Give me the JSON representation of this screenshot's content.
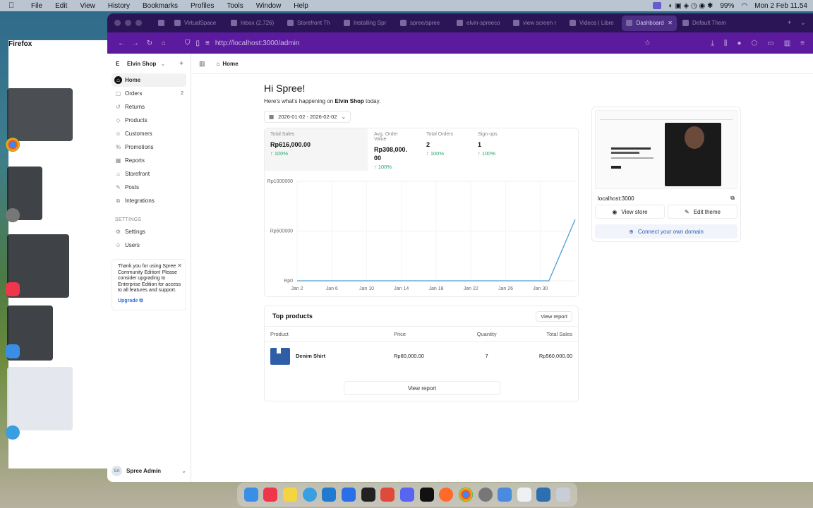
{
  "menubar": {
    "app": "Firefox",
    "items": [
      "File",
      "Edit",
      "View",
      "History",
      "Bookmarks",
      "Profiles",
      "Tools",
      "Window",
      "Help"
    ],
    "battery": "99%",
    "clock": "Mon 2 Feb  11.54"
  },
  "browser": {
    "tabs": [
      "VirtualSpace",
      "Inbox (2,726)",
      "Storefront Th",
      "Installing Spr",
      "spree/spree",
      "elvin-spreeco",
      "view screen r",
      "Videos | Libre",
      "Dashboard",
      "Default Them"
    ],
    "active_tab": "Dashboard",
    "url": "http://localhost:3000/admin"
  },
  "sidebar": {
    "shop_initial": "E",
    "shop_name": "Elvin Shop",
    "items": [
      {
        "label": "Home",
        "count": ""
      },
      {
        "label": "Orders",
        "count": "2"
      },
      {
        "label": "Returns",
        "count": ""
      },
      {
        "label": "Products",
        "count": ""
      },
      {
        "label": "Customers",
        "count": ""
      },
      {
        "label": "Promotions",
        "count": ""
      },
      {
        "label": "Reports",
        "count": ""
      },
      {
        "label": "Storefront",
        "count": ""
      },
      {
        "label": "Posts",
        "count": ""
      },
      {
        "label": "Integrations",
        "count": ""
      }
    ],
    "settings_label": "SETTINGS",
    "settings_items": [
      "Settings",
      "Users"
    ],
    "notice_text": "Thank you for using Spree Community Edition! Please consider upgrading to Enterprise Edition for access to all features and support.",
    "upgrade_label": "Upgrade",
    "user_name": "Spree Admin",
    "user_initials": "SA"
  },
  "topbar": {
    "crumb": "Home"
  },
  "main": {
    "greeting": "Hi Spree!",
    "sub_prefix": "Here's what's happening on ",
    "sub_shop": "Elvin Shop",
    "sub_suffix": " today.",
    "date_range": "2026-01-02 - 2026-02-02",
    "stats": [
      {
        "label": "Total Sales",
        "value": "Rp616,000.00",
        "change": "100%"
      },
      {
        "label": "Avg. Order Value",
        "value": "Rp308,000.00",
        "change": "100%"
      },
      {
        "label": "Total Orders",
        "value": "2",
        "change": "100%"
      },
      {
        "label": "Sign-ups",
        "value": "1",
        "change": "100%"
      }
    ]
  },
  "chart_data": {
    "type": "line",
    "x": [
      "Jan 2",
      "Jan 6",
      "Jan 10",
      "Jan 14",
      "Jan 18",
      "Jan 22",
      "Jan 26",
      "Jan 30",
      "Feb 2"
    ],
    "x_ticks": [
      "Jan 2",
      "Jan 6",
      "Jan 10",
      "Jan 14",
      "Jan 18",
      "Jan 22",
      "Jan 26",
      "Jan 30"
    ],
    "y_ticks": [
      "Rp0",
      "Rp500000",
      "Rp1000000"
    ],
    "series": [
      {
        "values": [
          0,
          0,
          0,
          0,
          0,
          0,
          0,
          0,
          616000
        ]
      }
    ],
    "ylim": [
      0,
      1000000
    ],
    "color": "#4a9fd8"
  },
  "top_products": {
    "title": "Top products",
    "view_report": "View report",
    "columns": [
      "Product",
      "Price",
      "Quantity",
      "Total Sales"
    ],
    "rows": [
      {
        "name": "Denim Shirt",
        "price": "Rp80,000.00",
        "quantity": "7",
        "total": "Rp560,000.00"
      }
    ],
    "footer_button": "View report"
  },
  "store": {
    "domain": "localhost:3000",
    "view_store": "View store",
    "edit_theme": "Edit theme",
    "connect": "Connect your own domain"
  }
}
